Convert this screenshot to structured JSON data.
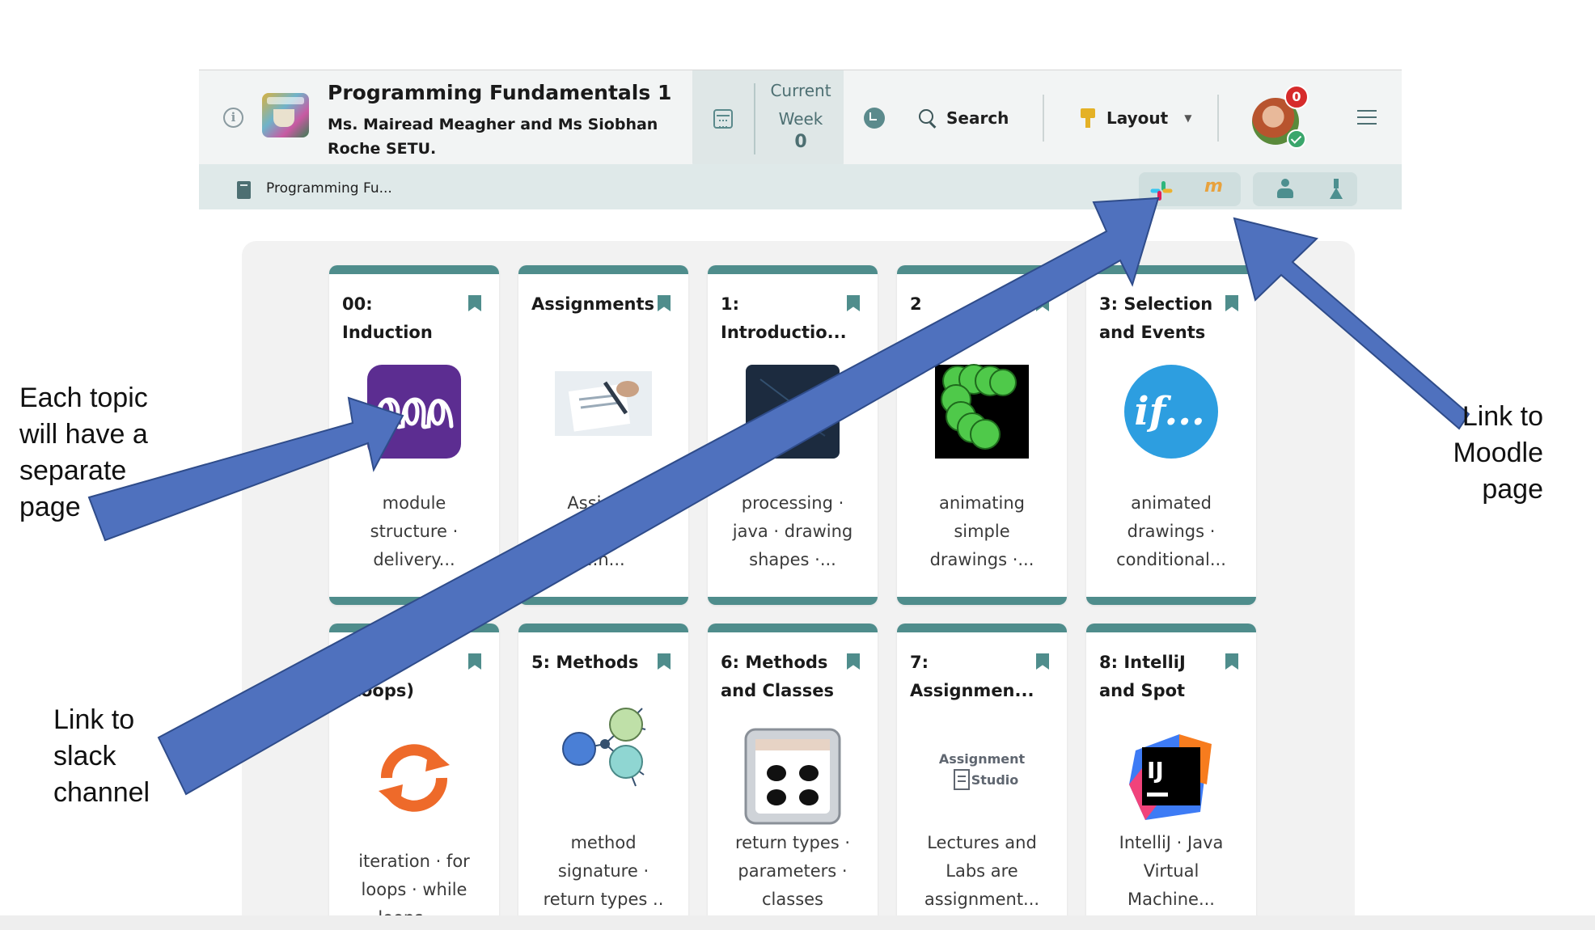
{
  "header": {
    "course_title": "Programming Fundamentals 1",
    "course_subtitle": "Ms. Mairead Meagher and Ms Siobhan Roche SETU.",
    "week_label": "Current Week",
    "week_number": "0",
    "search_label": "Search",
    "layout_label": "Layout",
    "notification_count": "0"
  },
  "breadcrumb": {
    "text": "Programming Fu..."
  },
  "topics": [
    {
      "title": "00:\nInduction",
      "desc": "module\nstructure ·\ndelivery...",
      "image": "spiral-icon"
    },
    {
      "title": "Assignments",
      "desc": "Assignm\nde\n...n...",
      "image": "document-signing-photo"
    },
    {
      "title": "1:\nIntroductio...",
      "desc": "processing ·\njava · drawing\nshapes ·...",
      "image": "dark-computer-photo"
    },
    {
      "title": "2",
      "desc": "animating\nsimple\ndrawings ·...",
      "image": "green-circles-animation"
    },
    {
      "title": "3: Selection\nand Events",
      "desc": "animated\ndrawings ·\nconditional...",
      "image": "if-logo"
    },
    {
      "title": "...tion\n(Loops)",
      "desc": "iteration · for\nloops · while\nloops ·...",
      "image": "loop-arrows-icon"
    },
    {
      "title": "5: Methods",
      "desc": "method\nsignature ·\nreturn types ..",
      "image": "network-nodes-icon"
    },
    {
      "title": "6: Methods\nand Classes",
      "desc": "return types ·\nparameters ·\nclasses",
      "image": "bingo-balls-image"
    },
    {
      "title": "7:\nAssignmen...",
      "desc": "Lectures and\nLabs are\nassignment...",
      "image": "assignment-studio-logo"
    },
    {
      "title": "8: IntelliJ\nand Spot",
      "desc": "IntelliJ · Java\nVirtual\nMachine...",
      "image": "intellij-logo"
    }
  ],
  "annotations": {
    "topic_page": "Each topic\nwill have a\nseparate\npage",
    "slack": "Link to\nslack\nchannel",
    "moodle": "Link to\nMoodle\npage"
  },
  "colors": {
    "accent": "#4f8d8c",
    "arrow_fill": "#4f71be",
    "arrow_stroke": "#2f4c8a",
    "badge_red": "#d62b2b"
  }
}
